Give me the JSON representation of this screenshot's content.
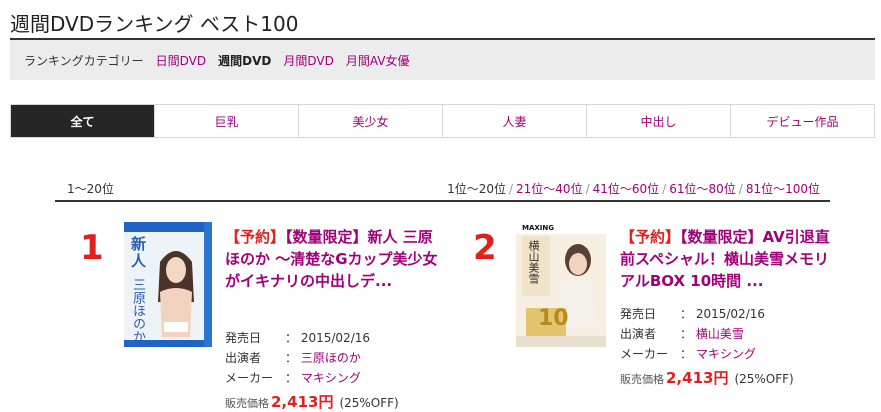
{
  "page_title": "週間DVDランキング ベスト100",
  "category_bar": {
    "label": "ランキングカテゴリー",
    "links": [
      "日間DVD",
      "週間DVD",
      "月間DVD",
      "月間AV女優"
    ],
    "active_index": 1
  },
  "tabs": [
    "全て",
    "巨乳",
    "美少女",
    "人妻",
    "中出し",
    "デビュー作品"
  ],
  "active_tab": 0,
  "range": {
    "current": "1〜20位",
    "pages": [
      "1位〜20位",
      "21位〜40位",
      "41位〜60位",
      "61位〜80位",
      "81位〜100位"
    ],
    "separator": "/"
  },
  "items": [
    {
      "rank": "1",
      "tag1": "【予約】",
      "tag2": "【数量限定】",
      "title": "新人 三原ほのか 〜清楚なGカップ美少女がイキナリの中出しデ...",
      "release_label": "発売日",
      "release_date": "2015/02/16",
      "cast_label": "出演者",
      "cast": "三原ほのか",
      "maker_label": "メーカー",
      "maker": "マキシング",
      "colon": "：",
      "price_label": "販売価格",
      "price": "2,413円",
      "discount": "(25%OFF)",
      "cover_text": [
        "新人",
        "三原ほのか"
      ]
    },
    {
      "rank": "2",
      "tag1": "【予約】",
      "tag2": "【数量限定】",
      "title": "AV引退直前スペシャル！横山美雪メモリアルBOX 10時間 ...",
      "release_label": "発売日",
      "release_date": "2015/02/16",
      "cast_label": "出演者",
      "cast": "横山美雪",
      "maker_label": "メーカー",
      "maker": "マキシング",
      "colon": "：",
      "price_label": "販売価格",
      "price": "2,413円",
      "discount": "(25%OFF)",
      "cover_text": [
        "MAXING",
        "横山美雪",
        "10"
      ]
    }
  ]
}
